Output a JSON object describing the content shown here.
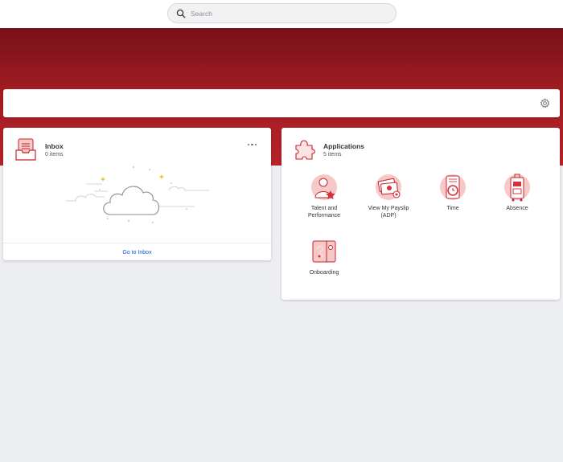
{
  "search": {
    "placeholder": "Search"
  },
  "inbox": {
    "title": "Inbox",
    "count": "0 items",
    "footer_link": "Go to Inbox"
  },
  "applications": {
    "title": "Applications",
    "count": "5 items",
    "apps": [
      {
        "label": "Talent and Performance",
        "icon": "talent-icon"
      },
      {
        "label": "View My Payslip (ADP)",
        "icon": "payslip-icon"
      },
      {
        "label": "Time",
        "icon": "time-icon"
      },
      {
        "label": "Absence",
        "icon": "absence-icon"
      },
      {
        "label": "Onboarding",
        "icon": "onboarding-icon"
      }
    ]
  },
  "colors": {
    "brand_dark": "#78101a",
    "brand": "#b8222a",
    "icon_red": "#d9303a",
    "icon_pink": "#f6c9c9",
    "link": "#0a5ad1"
  }
}
